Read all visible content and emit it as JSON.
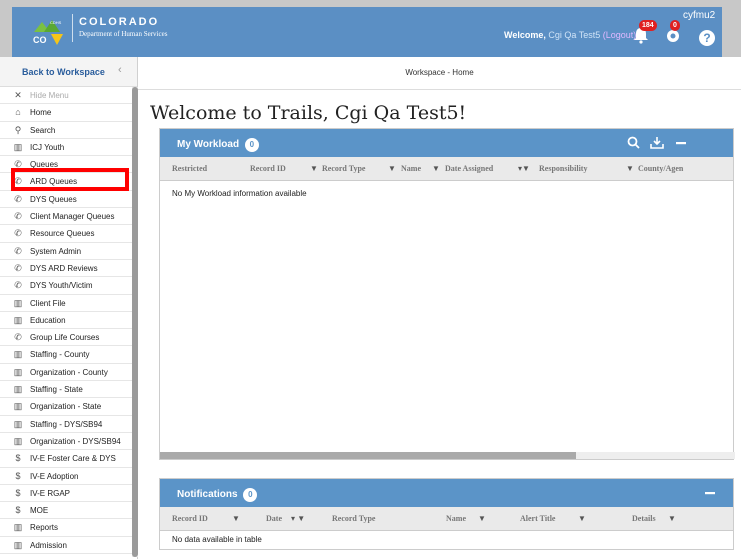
{
  "header": {
    "logo_cdhs": "CDHS",
    "logo_co": "CO",
    "logo_title": "COLORADO",
    "logo_subtitle": "Department of Human Services",
    "welcome_prefix": "Welcome, ",
    "user_display_name": "Cgi Qa Test5",
    "logout_label": "(Logout)",
    "username": "cyfmu2",
    "notifications_count": "184",
    "account_count": "0",
    "help_label": "?"
  },
  "breadcrumb": "Workspace - Home",
  "page_title": "Welcome to Trails, Cgi Qa Test5!",
  "sidebar": {
    "back_label": "Back to Workspace",
    "back_chevron": "‹",
    "items": [
      {
        "label": "Hide Menu",
        "icon": "close-icon"
      },
      {
        "label": "Home",
        "icon": "home-icon"
      },
      {
        "label": "Search",
        "icon": "search-icon"
      },
      {
        "label": "ICJ Youth",
        "icon": "building-icon"
      },
      {
        "label": "Queues",
        "icon": "phone-icon"
      },
      {
        "label": "ARD Queues",
        "icon": "phone-icon"
      },
      {
        "label": "DYS Queues",
        "icon": "phone-icon"
      },
      {
        "label": "Client Manager Queues",
        "icon": "phone-icon"
      },
      {
        "label": "Resource Queues",
        "icon": "phone-icon"
      },
      {
        "label": "System Admin",
        "icon": "phone-icon"
      },
      {
        "label": "DYS ARD Reviews",
        "icon": "phone-icon"
      },
      {
        "label": "DYS Youth/Victim",
        "icon": "phone-icon"
      },
      {
        "label": "Client File",
        "icon": "building-icon"
      },
      {
        "label": "Education",
        "icon": "building-icon"
      },
      {
        "label": "Group Life Courses",
        "icon": "phone-icon"
      },
      {
        "label": "Staffing - County",
        "icon": "building-icon"
      },
      {
        "label": "Organization - County",
        "icon": "building-icon"
      },
      {
        "label": "Staffing - State",
        "icon": "building-icon"
      },
      {
        "label": "Organization - State",
        "icon": "building-icon"
      },
      {
        "label": "Staffing - DYS/SB94",
        "icon": "building-icon"
      },
      {
        "label": "Organization - DYS/SB94",
        "icon": "building-icon"
      },
      {
        "label": "IV-E Foster Care & DYS",
        "icon": "dollar-icon"
      },
      {
        "label": "IV-E Adoption",
        "icon": "dollar-icon"
      },
      {
        "label": "IV-E RGAP",
        "icon": "dollar-icon"
      },
      {
        "label": "MOE",
        "icon": "dollar-icon"
      },
      {
        "label": "Reports",
        "icon": "building-icon"
      },
      {
        "label": "Admission",
        "icon": "building-icon"
      }
    ]
  },
  "workload": {
    "title": "My Workload",
    "count": "0",
    "columns": [
      "Restricted",
      "Record ID",
      "Record Type",
      "Name",
      "Date Assigned",
      "Responsibility",
      "County/Agen"
    ],
    "empty_text": "No My Workload  information available"
  },
  "notifications": {
    "title": "Notifications",
    "count": "0",
    "columns": [
      "Record ID",
      "Date",
      "Record Type",
      "Name",
      "Alert Title",
      "Details"
    ],
    "empty_text": "No data available in table"
  },
  "colors": {
    "header_blue": "#5b8fc4",
    "panel_blue": "#5b94c8",
    "highlight_red": "#ff0000",
    "badge_red": "#e02020"
  }
}
